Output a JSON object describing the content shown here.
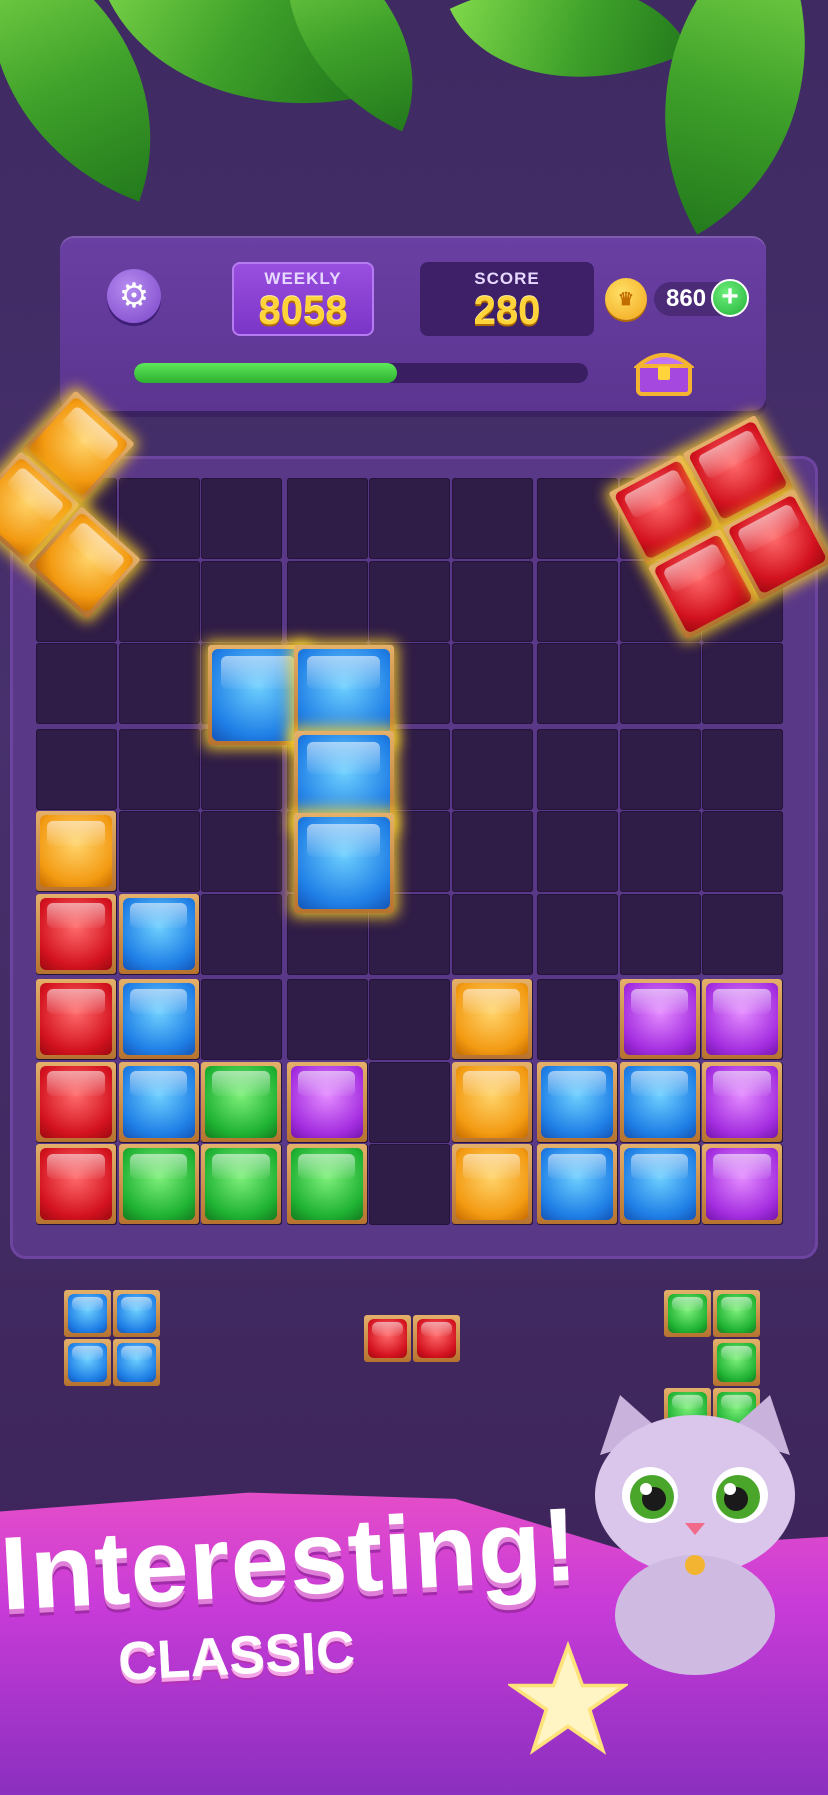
{
  "hud": {
    "weekly_label": "WEEKLY",
    "weekly_value": "8058",
    "score_label": "SCORE",
    "score_value": "280",
    "coins": "860",
    "progress_fraction": 0.58
  },
  "banner": {
    "title": "Interesting!",
    "subtitle": "CLASSIC"
  },
  "colors": {
    "red": "#d3121f",
    "blue": "#1f7fe6",
    "green": "#1fb233",
    "purple": "#a42ee0",
    "orange": "#f39a12"
  },
  "board": {
    "size": 9,
    "placed": [
      {
        "r": 4,
        "c": 0,
        "color": "orange"
      },
      {
        "r": 5,
        "c": 0,
        "color": "red"
      },
      {
        "r": 5,
        "c": 1,
        "color": "blue"
      },
      {
        "r": 6,
        "c": 0,
        "color": "red"
      },
      {
        "r": 6,
        "c": 1,
        "color": "blue"
      },
      {
        "r": 6,
        "c": 5,
        "color": "orange"
      },
      {
        "r": 6,
        "c": 7,
        "color": "purple"
      },
      {
        "r": 6,
        "c": 8,
        "color": "purple"
      },
      {
        "r": 7,
        "c": 0,
        "color": "red"
      },
      {
        "r": 7,
        "c": 1,
        "color": "blue"
      },
      {
        "r": 7,
        "c": 2,
        "color": "green"
      },
      {
        "r": 7,
        "c": 3,
        "color": "purple"
      },
      {
        "r": 7,
        "c": 5,
        "color": "orange"
      },
      {
        "r": 7,
        "c": 6,
        "color": "blue"
      },
      {
        "r": 7,
        "c": 7,
        "color": "blue"
      },
      {
        "r": 7,
        "c": 8,
        "color": "purple"
      },
      {
        "r": 8,
        "c": 0,
        "color": "red"
      },
      {
        "r": 8,
        "c": 1,
        "color": "green"
      },
      {
        "r": 8,
        "c": 2,
        "color": "green"
      },
      {
        "r": 8,
        "c": 3,
        "color": "green"
      },
      {
        "r": 8,
        "c": 5,
        "color": "orange"
      },
      {
        "r": 8,
        "c": 6,
        "color": "blue"
      },
      {
        "r": 8,
        "c": 7,
        "color": "blue"
      },
      {
        "r": 8,
        "c": 8,
        "color": "purple"
      }
    ],
    "dragging_piece": {
      "color": "blue",
      "cells": [
        [
          2,
          2
        ],
        [
          2,
          3
        ],
        [
          3,
          3
        ],
        [
          4,
          3
        ]
      ]
    }
  },
  "tray": [
    {
      "name": "tray-piece-blue-square",
      "color": "blue"
    },
    {
      "name": "tray-piece-red-domino",
      "color": "red"
    },
    {
      "name": "tray-piece-green-l",
      "color": "green"
    }
  ]
}
